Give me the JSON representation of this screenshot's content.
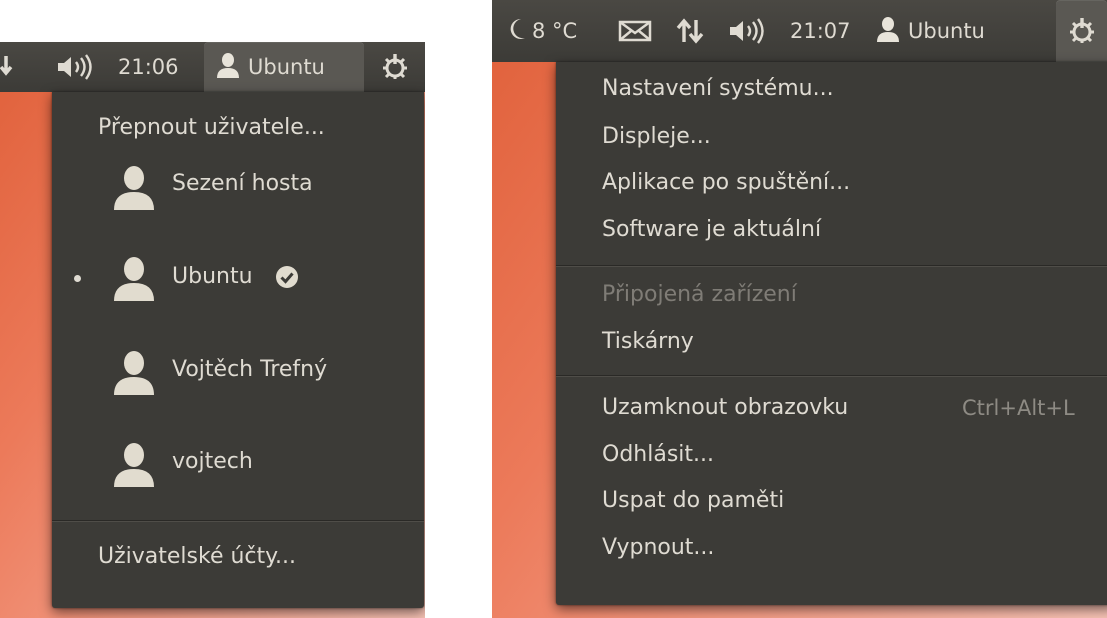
{
  "left": {
    "panel": {
      "clock": "21:06",
      "user_name": "Ubuntu",
      "icons": [
        "network-arrow-icon",
        "sound-icon",
        "user-icon",
        "power-gear-icon"
      ]
    },
    "menu": {
      "switch_user": "Přepnout uživatele...",
      "users": [
        {
          "name": "Sezení hosta",
          "icon": "user-silhouette-icon",
          "active": false,
          "logged_in": false
        },
        {
          "name": "Ubuntu",
          "icon": "user-silhouette-icon",
          "active": true,
          "logged_in": true
        },
        {
          "name": "Vojtěch Trefný",
          "icon": "user-silhouette-icon",
          "active": false,
          "logged_in": false
        },
        {
          "name": "vojtech",
          "icon": "user-silhouette-icon",
          "active": false,
          "logged_in": false
        }
      ],
      "user_accounts": "Uživatelské účty..."
    }
  },
  "right": {
    "panel": {
      "weather": "8 °C",
      "clock": "21:07",
      "user_name": "Ubuntu",
      "icons": [
        "moon-icon",
        "mail-icon",
        "network-updown-icon",
        "sound-icon",
        "user-icon",
        "power-gear-icon"
      ]
    },
    "menu": {
      "items": [
        {
          "label": "Nastavení systému...",
          "enabled": true
        },
        {
          "label": "Displeje...",
          "enabled": true
        },
        {
          "label": "Aplikace po spuštění...",
          "enabled": true
        },
        {
          "label": "Software je aktuální",
          "enabled": true
        },
        {
          "label": "Připojená zařízení",
          "enabled": false
        },
        {
          "label": "Tiskárny",
          "enabled": true
        },
        {
          "label": "Uzamknout obrazovku",
          "enabled": true,
          "shortcut": "Ctrl+Alt+L"
        },
        {
          "label": "Odhlásit...",
          "enabled": true
        },
        {
          "label": "Uspat do paměti",
          "enabled": true
        },
        {
          "label": "Vypnout...",
          "enabled": true
        }
      ]
    }
  },
  "colors": {
    "panel_bg": "#3c3b37",
    "menu_bg": "#3c3b37",
    "menu_text": "#dfdbd2",
    "disabled_text": "#7f7c76",
    "wallpaper_orange": "#e0603a"
  }
}
